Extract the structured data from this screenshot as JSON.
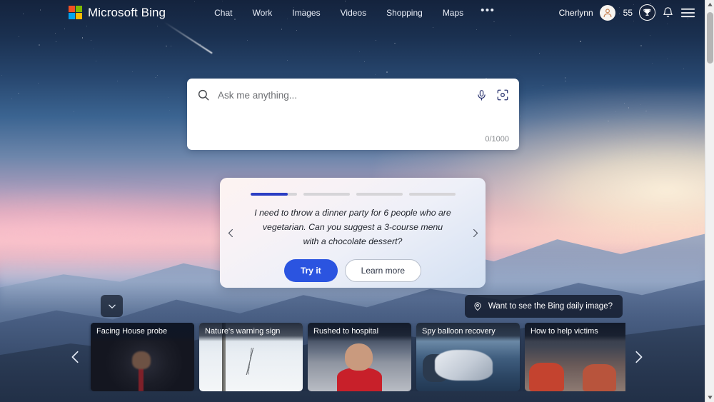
{
  "header": {
    "brand": "Microsoft Bing",
    "logo_colors": {
      "tl": "#f25022",
      "tr": "#7fba00",
      "bl": "#00a4ef",
      "br": "#ffb900"
    },
    "nav": [
      {
        "label": "Chat",
        "name": "nav-chat"
      },
      {
        "label": "Work",
        "name": "nav-work"
      },
      {
        "label": "Images",
        "name": "nav-images"
      },
      {
        "label": "Videos",
        "name": "nav-videos"
      },
      {
        "label": "Shopping",
        "name": "nav-shopping"
      },
      {
        "label": "Maps",
        "name": "nav-maps"
      }
    ],
    "more_label": "•••",
    "user_name": "Cherlynn",
    "rewards_points": "55"
  },
  "search": {
    "placeholder": "Ask me anything...",
    "value": "",
    "counter": "0/1000"
  },
  "suggestion_card": {
    "text": "I need to throw a dinner party for 6 people who are vegetarian. Can you suggest a 3-course menu with a chocolate dessert?",
    "primary_button": "Try it",
    "secondary_button": "Learn more",
    "progress": {
      "total": 4,
      "active_index": 0,
      "active_fill_percent": 80
    },
    "accent_color": "#2b3ec4",
    "primary_button_color": "#2b54e0"
  },
  "daily_image_pill": {
    "label": "Want to see the Bing daily image?"
  },
  "carousel": {
    "cards": [
      {
        "title": "Facing House probe",
        "photo_class": "ph1"
      },
      {
        "title": "Nature's warning sign",
        "photo_class": "ph2"
      },
      {
        "title": "Rushed to hospital",
        "photo_class": "ph3"
      },
      {
        "title": "Spy balloon recovery",
        "photo_class": "ph4"
      },
      {
        "title": "How to help victims",
        "photo_class": "ph5"
      }
    ]
  }
}
